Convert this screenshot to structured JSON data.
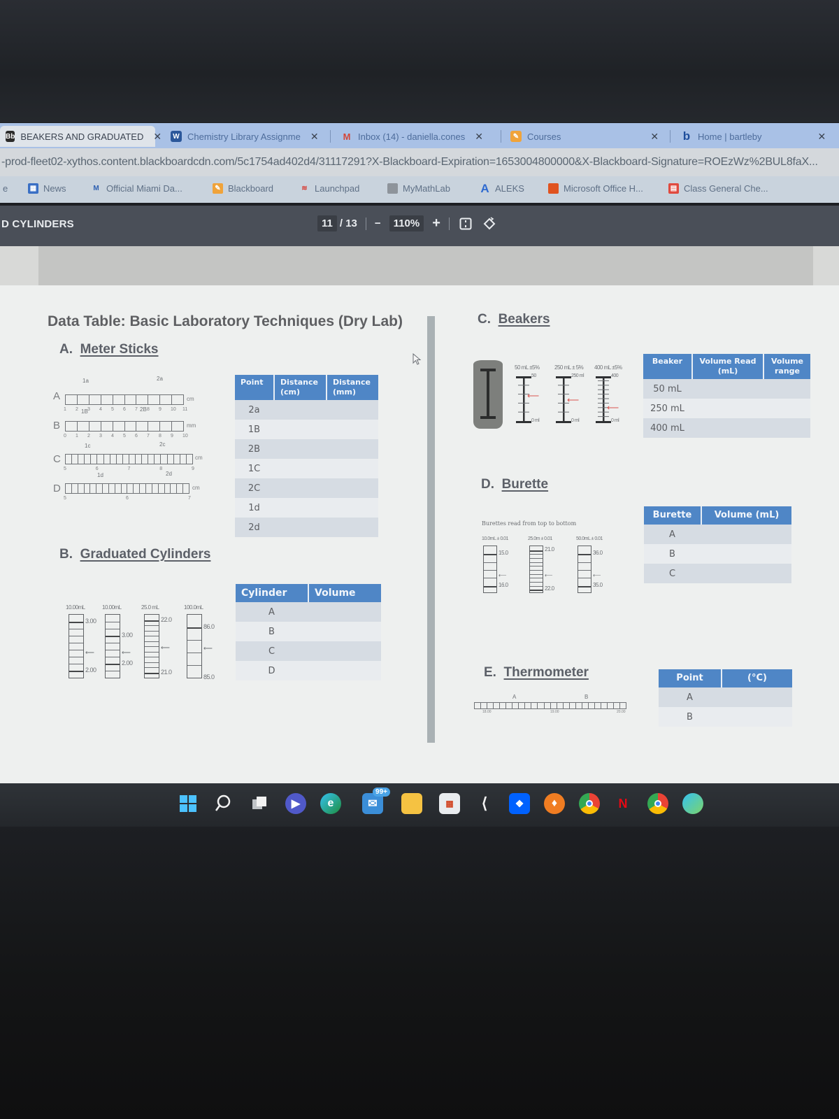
{
  "browser": {
    "tabs": [
      {
        "label": "BEAKERS AND GRADUATED",
        "favicon": "bb-icon",
        "active": true
      },
      {
        "label": "Chemistry Library Assignme",
        "favicon": "word-icon",
        "active": false
      },
      {
        "label": "Inbox (14) - daniella.cones",
        "favicon": "gmail-icon",
        "active": false
      },
      {
        "label": "Courses",
        "favicon": "blackboard-icon",
        "active": false
      },
      {
        "label": "Home | bartleby",
        "favicon": "bartleby-icon",
        "active": false
      }
    ],
    "url": "-prod-fleet02-xythos.content.blackboardcdn.com/5c1754ad402d4/31117291?X-Blackboard-Expiration=1653004800000&X-Blackboard-Signature=ROEzWz%2BUL8faX...",
    "bookmarks": [
      {
        "label": "News",
        "icon": "news-icon"
      },
      {
        "label": "Official Miami Da...",
        "icon": "mdc-icon"
      },
      {
        "label": "Blackboard",
        "icon": "blackboard-icon"
      },
      {
        "label": "Launchpad",
        "icon": "launchpad-icon"
      },
      {
        "label": "MyMathLab",
        "icon": "mymathlab-icon"
      },
      {
        "label": "ALEKS",
        "icon": "aleks-icon"
      },
      {
        "label": "Microsoft Office H...",
        "icon": "office-icon"
      },
      {
        "label": "Class General Che...",
        "icon": "class-icon"
      }
    ]
  },
  "pdf_viewer": {
    "doc_title": "D CYLINDERS",
    "current_page": "11",
    "total_pages": "/ 13",
    "zoom_out": "−",
    "zoom_level": "110%",
    "zoom_in": "+"
  },
  "document": {
    "title": "Data Table: Basic Laboratory Techniques (Dry Lab)",
    "sections": {
      "a": {
        "letter": "A.",
        "title": "Meter Sticks"
      },
      "b": {
        "letter": "B.",
        "title": "Graduated Cylinders"
      },
      "c": {
        "letter": "C.",
        "title": "Beakers"
      },
      "d": {
        "letter": "D.",
        "title": "Burette"
      },
      "e": {
        "letter": "E.",
        "title": "Thermometer"
      }
    },
    "meter_sticks": {
      "rulers": [
        {
          "label": "A",
          "unit": "cm",
          "ticks": [
            "1",
            "2",
            "3",
            "4",
            "5",
            "6",
            "7",
            "8",
            "9",
            "10",
            "11"
          ],
          "markers": [
            "1a",
            "2a"
          ]
        },
        {
          "label": "B",
          "unit": "mm",
          "ticks": [
            "0",
            "1",
            "2",
            "3",
            "4",
            "5",
            "6",
            "7",
            "8",
            "9",
            "10"
          ],
          "markers": [
            "1B",
            "2B"
          ]
        },
        {
          "label": "C",
          "unit": "cm",
          "ticks": [
            "5",
            "6",
            "7",
            "8",
            "9"
          ],
          "markers": [
            "1c",
            "2c"
          ]
        },
        {
          "label": "D",
          "unit": "cm",
          "ticks": [
            "5",
            "6",
            "7"
          ],
          "markers": [
            "1d",
            "2d"
          ]
        }
      ],
      "table": {
        "headers": [
          "Point",
          "Distance (cm)",
          "Distance (mm)"
        ],
        "rows": [
          [
            "2a",
            "",
            ""
          ],
          [
            "1B",
            "",
            ""
          ],
          [
            "2B",
            "",
            ""
          ],
          [
            "1C",
            "",
            ""
          ],
          [
            "2C",
            "",
            ""
          ],
          [
            "1d",
            "",
            ""
          ],
          [
            "2d",
            "",
            ""
          ]
        ]
      }
    },
    "graduated_cylinders": {
      "cylinders": [
        {
          "capacity": "10.00mL",
          "top": "3.00",
          "bottom": "2.00"
        },
        {
          "capacity": "10.00mL",
          "top": "3.00",
          "bottom": "2.00"
        },
        {
          "capacity": "25.0 mL",
          "top": "22.0",
          "bottom": "21.0"
        },
        {
          "capacity": "100.0mL",
          "top": "86.0",
          "bottom": "85.0"
        }
      ],
      "table": {
        "headers": [
          "Cylinder",
          "Volume"
        ],
        "rows": [
          [
            "A",
            ""
          ],
          [
            "B",
            ""
          ],
          [
            "C",
            ""
          ],
          [
            "D",
            ""
          ]
        ]
      }
    },
    "beakers": {
      "scales": [
        {
          "caption": "50 mL ±5%",
          "top": "50",
          "bottom": "0 ml"
        },
        {
          "caption": "250 mL ± 5%",
          "top": "250 ml",
          "bottom": "0 ml"
        },
        {
          "caption": "400 mL ±5%",
          "top": "400",
          "bottom": "0 ml"
        }
      ],
      "table": {
        "headers": [
          "Beaker",
          "Volume Read (mL)",
          "Volume range"
        ],
        "rows": [
          [
            "50 mL",
            "",
            ""
          ],
          [
            "250 mL",
            "",
            ""
          ],
          [
            "400 mL",
            "",
            ""
          ]
        ]
      }
    },
    "burette": {
      "note": "Burettes read from top to bottom",
      "burettes": [
        {
          "caption": "10.0mL ± 0.01",
          "top": "15.0",
          "bottom": "16.0"
        },
        {
          "caption": "25.0m ± 0.01",
          "top": "21.0",
          "bottom": "22.0"
        },
        {
          "caption": "50.0mL ± 0.01",
          "top": "36.0",
          "bottom": "35.0"
        }
      ],
      "table": {
        "headers": [
          "Burette",
          "Volume (mL)"
        ],
        "rows": [
          [
            "A",
            ""
          ],
          [
            "B",
            ""
          ],
          [
            "C",
            ""
          ]
        ]
      }
    },
    "thermometer": {
      "markers": [
        "A",
        "B"
      ],
      "ticks": [
        "18.00",
        "19.00",
        "20.00"
      ],
      "table": {
        "headers": [
          "Point",
          "(°C)"
        ],
        "rows": [
          [
            "A",
            ""
          ],
          [
            "B",
            ""
          ]
        ]
      }
    }
  },
  "taskbar": {
    "icons": [
      "windows-start-icon",
      "search-icon",
      "task-view-icon",
      "teams-icon",
      "edge-icon",
      "mail-icon",
      "file-explorer-icon",
      "store-icon",
      "app-icon",
      "dropbox-icon",
      "brave-icon",
      "chrome-profile-icon",
      "netflix-icon",
      "chrome-icon",
      "edge-alt-icon"
    ],
    "mail_badge": "99+"
  }
}
